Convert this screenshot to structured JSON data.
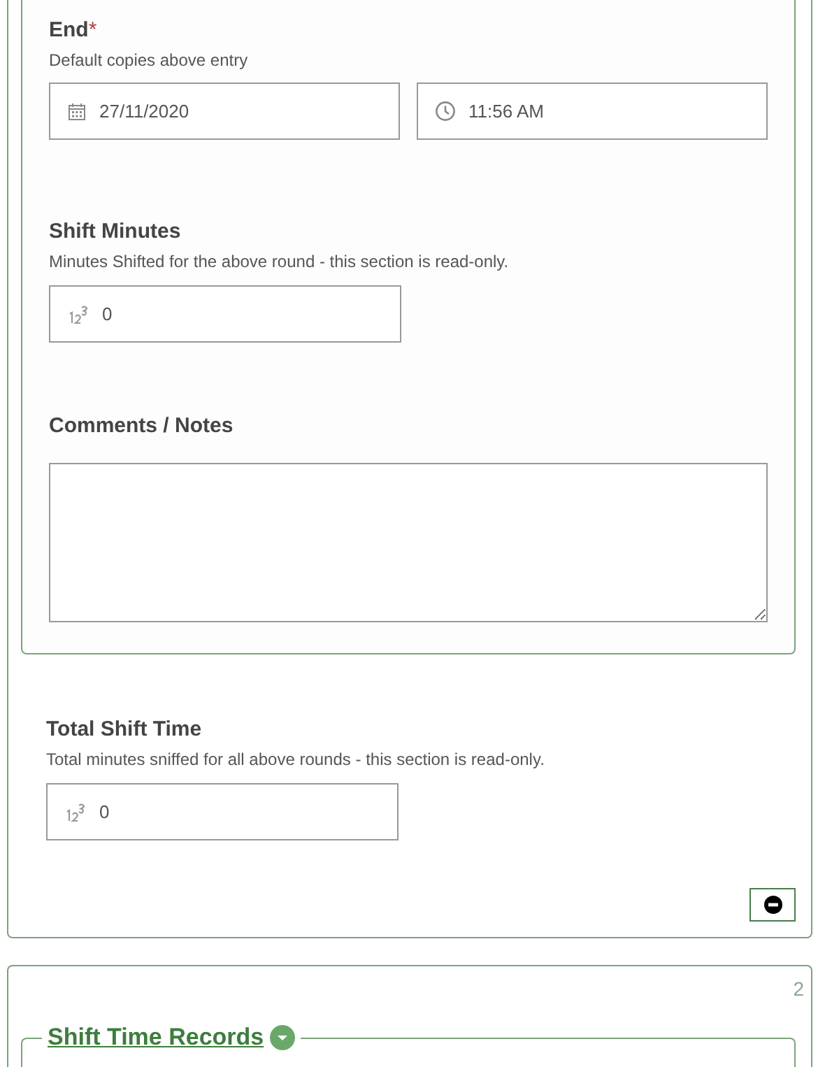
{
  "end": {
    "label": "End",
    "required_mark": "*",
    "hint": "Default copies above entry",
    "date": "27/11/2020",
    "time": "11:56 AM"
  },
  "shift_minutes": {
    "label": "Shift Minutes",
    "hint": "Minutes Shifted for the above round - this section is read-only.",
    "value": "0"
  },
  "comments": {
    "label": "Comments / Notes"
  },
  "total_shift_time": {
    "label": "Total Shift Time",
    "hint": "Total minutes sniffed for all above rounds - this section is read-only.",
    "value": "0"
  },
  "next_section": {
    "index": "2",
    "title": "Shift Time Records",
    "expanded": true
  }
}
